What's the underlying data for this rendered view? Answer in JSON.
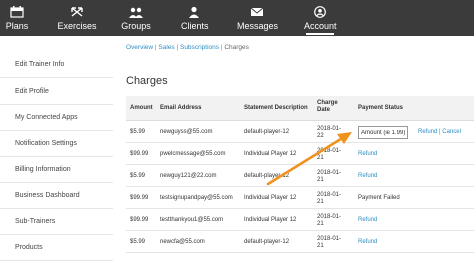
{
  "nav": {
    "items": [
      {
        "label": "Plans",
        "icon": "calendar-icon"
      },
      {
        "label": "Exercises",
        "icon": "arrows-icon"
      },
      {
        "label": "Groups",
        "icon": "group-icon"
      },
      {
        "label": "Clients",
        "icon": "person-icon"
      },
      {
        "label": "Messages",
        "icon": "envelope-icon"
      },
      {
        "label": "Account",
        "icon": "account-icon",
        "active": true
      }
    ]
  },
  "sidebar": {
    "items": [
      {
        "label": "Edit Trainer Info"
      },
      {
        "label": "Edit Profile"
      },
      {
        "label": "My Connected Apps"
      },
      {
        "label": "Notification Settings"
      },
      {
        "label": "Billing Information"
      },
      {
        "label": "Business Dashboard"
      },
      {
        "label": "Sub-Trainers"
      },
      {
        "label": "Products"
      }
    ]
  },
  "breadcrumb": {
    "overview": "Overview",
    "sales": "Sales",
    "subscriptions": "Subscriptions",
    "current": "Charges",
    "sep": " | "
  },
  "page": {
    "title": "Charges"
  },
  "table": {
    "headers": {
      "amount": "Amount",
      "email": "Email Address",
      "statement": "Statement Description",
      "charge_date_1": "Charge",
      "charge_date_2": "Date",
      "status": "Payment Status"
    },
    "rows": [
      {
        "amount": "$5.99",
        "email": "newguyss@55.com",
        "statement": "default-player-12",
        "date1": "2018-01-",
        "date2": "22",
        "status": "",
        "input_value": "Amount (ie 1.99)",
        "refund": "Refund",
        "divider": " | ",
        "cancel": "Cancel"
      },
      {
        "amount": "$99.99",
        "email": "pwelcmessage@55.com",
        "statement": "Individual Player 12",
        "date1": "2018-01-",
        "date2": "21",
        "status": "",
        "refund": "Refund"
      },
      {
        "amount": "$5.99",
        "email": "newguy121@22.com",
        "statement": "default-player-12",
        "date1": "2018-01-",
        "date2": "21",
        "status": "",
        "refund": "Refund"
      },
      {
        "amount": "$99.99",
        "email": "testsignupandpay@55.com",
        "statement": "Individual Player 12",
        "date1": "2018-01-",
        "date2": "21",
        "status": "Payment Failed",
        "refund": ""
      },
      {
        "amount": "$99.99",
        "email": "testthankyou1@55.com",
        "statement": "Individual Player 12",
        "date1": "2018-01-",
        "date2": "21",
        "status": "",
        "refund": "Refund"
      },
      {
        "amount": "$5.99",
        "email": "newcfa@55.com",
        "statement": "default-player-12",
        "date1": "2018-01-",
        "date2": "21",
        "status": "",
        "refund": "Refund"
      }
    ]
  },
  "colors": {
    "accent": "#2e8fc4",
    "annotation_arrow": "#f0931e",
    "navbar": "#3b3b3b"
  }
}
